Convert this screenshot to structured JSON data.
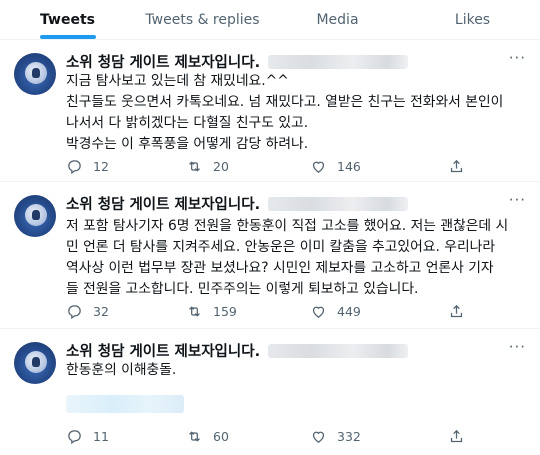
{
  "tabs": [
    {
      "label": "Tweets",
      "active": true
    },
    {
      "label": "Tweets & replies",
      "active": false
    },
    {
      "label": "Media",
      "active": false
    },
    {
      "label": "Likes",
      "active": false
    }
  ],
  "accent_color": "#1d9bf0",
  "more_icon": "···",
  "tweets": [
    {
      "name": "소위 청담 게이트 제보자입니다.",
      "lines": [
        "지금 탐사보고 있는데 참 재밌네요.^^",
        "친구들도 웃으면서 카톡오네요. 넘 재밌다고. 열받은 친구는 전화와서 본인이",
        "나서서 다 밝히겠다는 다혈질 친구도 있고.",
        "박경수는 이 후폭풍을 어떻게 감당 하려나."
      ],
      "replies": "12",
      "retweets": "20",
      "likes": "146"
    },
    {
      "name": "소위 청담 게이트 제보자입니다.",
      "lines": [
        "저 포함 탐사기자 6명 전원을 한동훈이 직접 고소를 했어요. 저는 괜찮은데 시",
        "민 언론 더 탐사를 지켜주세요. 안농운은 이미 칼춤을 추고있어요. 우리나라",
        "역사상 이런 법무부 장관 보셨나요? 시민인 제보자를 고소하고 언론사 기자",
        "들 전원을 고소합니다.  민주주의는 이렇게 퇴보하고 있습니다."
      ],
      "replies": "32",
      "retweets": "159",
      "likes": "449"
    },
    {
      "name": "소위 청담 게이트 제보자입니다.",
      "lines": [
        "한동훈의 이해충돌."
      ],
      "replies": "11",
      "retweets": "60",
      "likes": "332"
    }
  ]
}
